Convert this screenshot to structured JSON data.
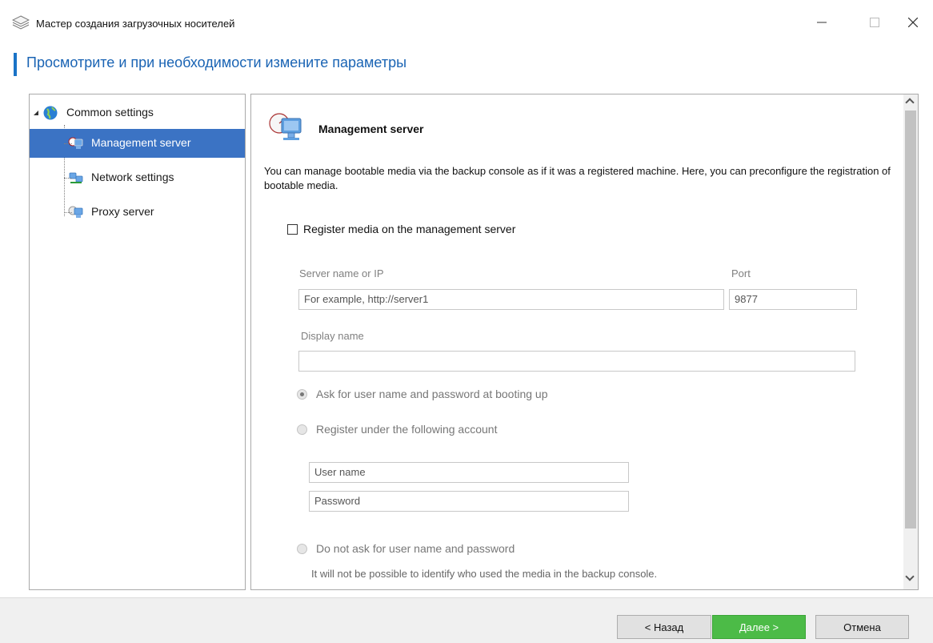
{
  "window": {
    "title": "Мастер создания загрузочных носителей",
    "icon": "layers-icon"
  },
  "header": {
    "title": "Просмотрите и при необходимости измените параметры"
  },
  "tree": {
    "root": {
      "label": "Common settings",
      "icon": "globe-icon",
      "expanded": true
    },
    "items": [
      {
        "label": "Management server",
        "icon": "management-server-icon",
        "selected": true
      },
      {
        "label": "Network settings",
        "icon": "network-icon",
        "selected": false
      },
      {
        "label": "Proxy server",
        "icon": "proxy-server-icon",
        "selected": false
      }
    ]
  },
  "content": {
    "title": "Management server",
    "description": "You can manage bootable media via the backup console as if it was a registered machine. Here, you can preconfigure the registration of bootable media.",
    "register_checkbox": {
      "label": "Register media on the management server",
      "checked": false
    },
    "server_field": {
      "label": "Server name or IP",
      "placeholder": "For example, http://server1"
    },
    "port_field": {
      "label": "Port",
      "value": "9877"
    },
    "display_name_field": {
      "label": "Display name",
      "value": ""
    },
    "auth_options": [
      {
        "label": "Ask for user name and password at booting up",
        "checked": true
      },
      {
        "label": "Register under the following account",
        "checked": false
      },
      {
        "label": "Do not ask for user name and password",
        "checked": false
      }
    ],
    "username_field": {
      "placeholder": "User name"
    },
    "password_field": {
      "placeholder": "Password"
    },
    "note": "It will not be possible to identify who used the media in the backup console."
  },
  "footer": {
    "back_label": "< Назад",
    "next_label": "Далее >",
    "cancel_label": "Отмена"
  },
  "colors": {
    "accent": "#1a73c7",
    "selection": "#3b73c4",
    "next_button": "#4cbb47"
  }
}
